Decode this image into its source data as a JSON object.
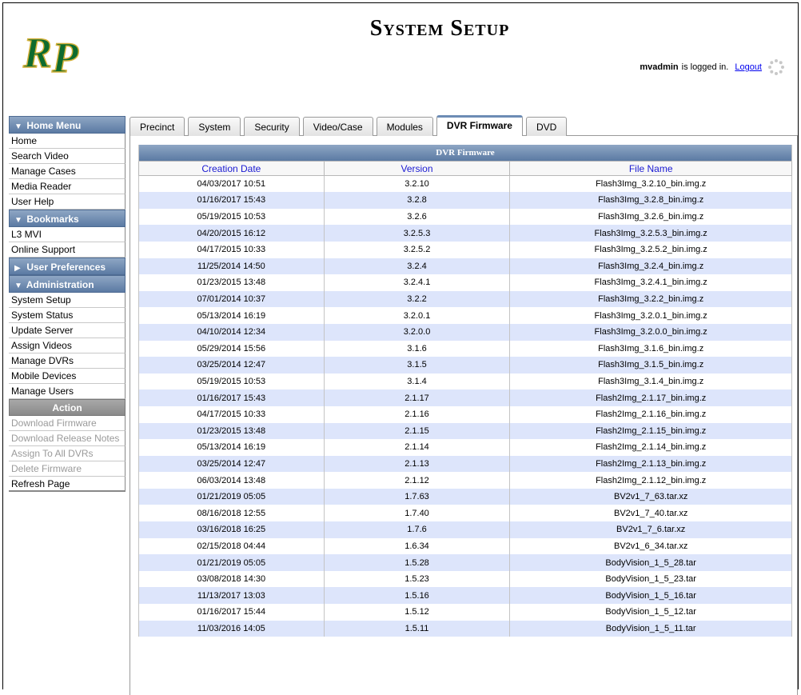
{
  "header": {
    "title": "System Setup",
    "logo_text": "RP",
    "user": "mvadmin",
    "logged_in_text": "is logged in.",
    "logout_label": "Logout"
  },
  "sidebar": {
    "home_menu": {
      "title": "Home Menu",
      "items": [
        "Home",
        "Search Video",
        "Manage Cases",
        "Media Reader",
        "User Help"
      ]
    },
    "bookmarks": {
      "title": "Bookmarks",
      "items": [
        "L3 MVI",
        "Online Support"
      ]
    },
    "user_preferences": {
      "title": "User Preferences"
    },
    "administration": {
      "title": "Administration",
      "items": [
        "System Setup",
        "System Status",
        "Update Server",
        "Assign Videos",
        "Manage DVRs",
        "Mobile Devices",
        "Manage Users"
      ]
    },
    "action": {
      "title": "Action",
      "items": [
        {
          "label": "Download Firmware",
          "enabled": false
        },
        {
          "label": "Download Release Notes",
          "enabled": false
        },
        {
          "label": "Assign To All DVRs",
          "enabled": false
        },
        {
          "label": "Delete Firmware",
          "enabled": false
        },
        {
          "label": "Refresh Page",
          "enabled": true
        }
      ]
    }
  },
  "tabs": [
    {
      "label": "Precinct",
      "active": false
    },
    {
      "label": "System",
      "active": false
    },
    {
      "label": "Security",
      "active": false
    },
    {
      "label": "Video/Case",
      "active": false
    },
    {
      "label": "Modules",
      "active": false
    },
    {
      "label": "DVR Firmware",
      "active": true
    },
    {
      "label": "DVD",
      "active": false
    }
  ],
  "grid": {
    "title": "DVR Firmware",
    "columns": [
      "Creation Date",
      "Version",
      "File Name"
    ],
    "rows": [
      [
        "04/03/2017 10:51",
        "3.2.10",
        "Flash3Img_3.2.10_bin.img.z"
      ],
      [
        "01/16/2017 15:43",
        "3.2.8",
        "Flash3Img_3.2.8_bin.img.z"
      ],
      [
        "05/19/2015 10:53",
        "3.2.6",
        "Flash3Img_3.2.6_bin.img.z"
      ],
      [
        "04/20/2015 16:12",
        "3.2.5.3",
        "Flash3Img_3.2.5.3_bin.img.z"
      ],
      [
        "04/17/2015 10:33",
        "3.2.5.2",
        "Flash3Img_3.2.5.2_bin.img.z"
      ],
      [
        "11/25/2014 14:50",
        "3.2.4",
        "Flash3Img_3.2.4_bin.img.z"
      ],
      [
        "01/23/2015 13:48",
        "3.2.4.1",
        "Flash3Img_3.2.4.1_bin.img.z"
      ],
      [
        "07/01/2014 10:37",
        "3.2.2",
        "Flash3Img_3.2.2_bin.img.z"
      ],
      [
        "05/13/2014 16:19",
        "3.2.0.1",
        "Flash3Img_3.2.0.1_bin.img.z"
      ],
      [
        "04/10/2014 12:34",
        "3.2.0.0",
        "Flash3Img_3.2.0.0_bin.img.z"
      ],
      [
        "05/29/2014 15:56",
        "3.1.6",
        "Flash3Img_3.1.6_bin.img.z"
      ],
      [
        "03/25/2014 12:47",
        "3.1.5",
        "Flash3Img_3.1.5_bin.img.z"
      ],
      [
        "05/19/2015 10:53",
        "3.1.4",
        "Flash3Img_3.1.4_bin.img.z"
      ],
      [
        "01/16/2017 15:43",
        "2.1.17",
        "Flash2Img_2.1.17_bin.img.z"
      ],
      [
        "04/17/2015 10:33",
        "2.1.16",
        "Flash2Img_2.1.16_bin.img.z"
      ],
      [
        "01/23/2015 13:48",
        "2.1.15",
        "Flash2Img_2.1.15_bin.img.z"
      ],
      [
        "05/13/2014 16:19",
        "2.1.14",
        "Flash2Img_2.1.14_bin.img.z"
      ],
      [
        "03/25/2014 12:47",
        "2.1.13",
        "Flash2Img_2.1.13_bin.img.z"
      ],
      [
        "06/03/2014 13:48",
        "2.1.12",
        "Flash2Img_2.1.12_bin.img.z"
      ],
      [
        "01/21/2019 05:05",
        "1.7.63",
        "BV2v1_7_63.tar.xz"
      ],
      [
        "08/16/2018 12:55",
        "1.7.40",
        "BV2v1_7_40.tar.xz"
      ],
      [
        "03/16/2018 16:25",
        "1.7.6",
        "BV2v1_7_6.tar.xz"
      ],
      [
        "02/15/2018 04:44",
        "1.6.34",
        "BV2v1_6_34.tar.xz"
      ],
      [
        "01/21/2019 05:05",
        "1.5.28",
        "BodyVision_1_5_28.tar"
      ],
      [
        "03/08/2018 14:30",
        "1.5.23",
        "BodyVision_1_5_23.tar"
      ],
      [
        "11/13/2017 13:03",
        "1.5.16",
        "BodyVision_1_5_16.tar"
      ],
      [
        "01/16/2017 15:44",
        "1.5.12",
        "BodyVision_1_5_12.tar"
      ],
      [
        "11/03/2016 14:05",
        "1.5.11",
        "BodyVision_1_5_11.tar"
      ]
    ]
  },
  "colors": {
    "header_blue": "#5b7aa3",
    "row_alt": "#dde5fb",
    "logo_green": "#0e6b2e",
    "logo_gold": "#d4b13a"
  },
  "icons": {
    "expanded": "down-triangle",
    "collapsed": "right-triangle",
    "loading": "spinner-icon"
  }
}
